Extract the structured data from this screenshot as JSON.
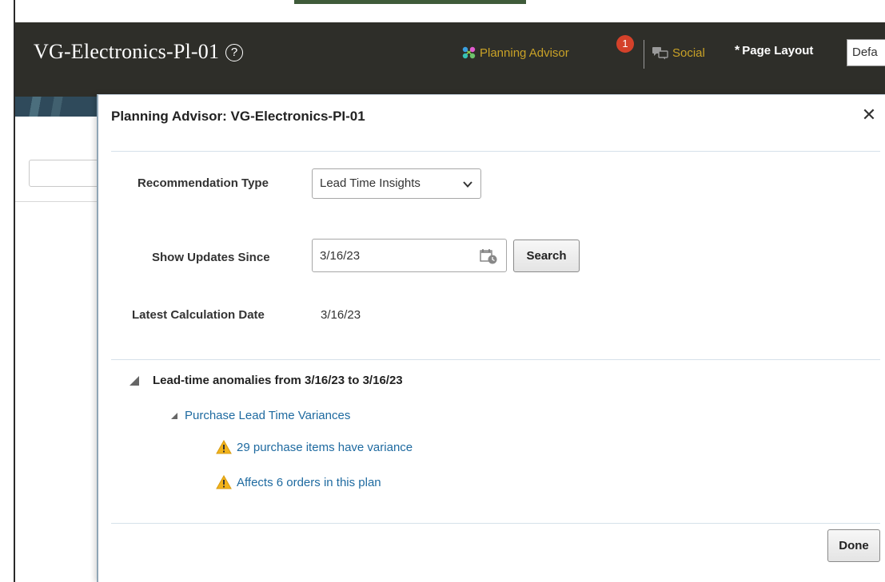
{
  "header": {
    "title": "VG-Electronics-Pl-01",
    "help_symbol": "?",
    "planning_advisor_label": "Planning Advisor",
    "planning_advisor_badge": "1",
    "social_label": "Social",
    "page_layout_required": "*",
    "page_layout_label": "Page Layout",
    "page_layout_value": "Defa"
  },
  "dialog": {
    "title": "Planning Advisor: VG-Electronics-PI-01",
    "close_symbol": "✕",
    "form": {
      "recommendation_type_label": "Recommendation Type",
      "recommendation_type_value": "Lead Time Insights",
      "show_updates_since_label": "Show Updates Since",
      "show_updates_since_value": "3/16/23",
      "search_button": "Search",
      "latest_calculation_date_label": "Latest Calculation Date",
      "latest_calculation_date_value": "3/16/23"
    },
    "tree": {
      "root_label": "Lead-time anomalies from 3/16/23 to 3/16/23",
      "group_label": "Purchase Lead Time Variances",
      "items": [
        {
          "label": "29 purchase items have variance"
        },
        {
          "label": "Affects 6 orders in this plan"
        }
      ]
    },
    "done_button": "Done"
  },
  "colors": {
    "header_bg": "#2e2e29",
    "link_gold": "#c9a227",
    "link_blue": "#1e6aa0",
    "badge_red": "#d4412a",
    "warning_yellow": "#f2b31b"
  }
}
